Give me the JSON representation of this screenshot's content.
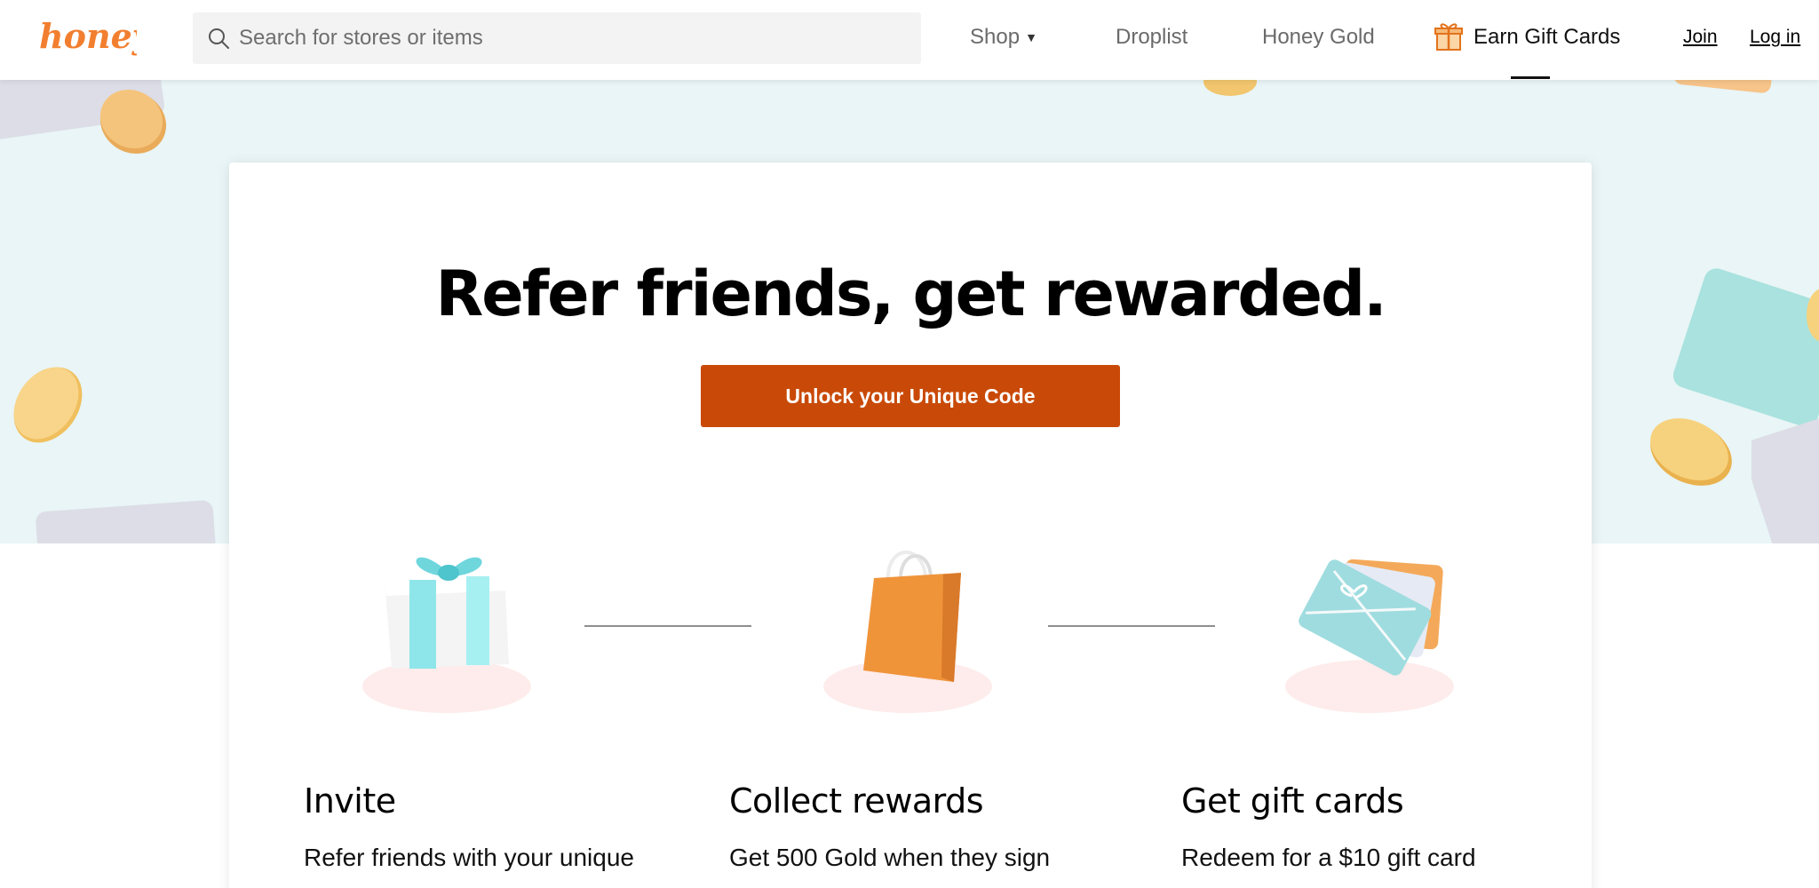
{
  "header": {
    "logo_text": "honey",
    "search": {
      "placeholder": "Search for stores or items",
      "value": ""
    },
    "nav": {
      "shop": "Shop",
      "droplist": "Droplist",
      "honey_gold": "Honey Gold",
      "earn_gift_cards": "Earn Gift Cards"
    },
    "join": "Join",
    "login": "Log in"
  },
  "hero": {
    "title": "Refer friends, get rewarded.",
    "cta_label": "Unlock your Unique Code"
  },
  "steps": [
    {
      "title": "Invite",
      "description": "Refer friends with your unique"
    },
    {
      "title": "Collect rewards",
      "description": "Get 500 Gold when they sign"
    },
    {
      "title": "Get gift cards",
      "description": "Redeem for a $10 gift card"
    }
  ],
  "colors": {
    "brand_orange": "#c94a08",
    "logo_orange": "#f27f2f",
    "hero_background": "#e9f5f6"
  }
}
